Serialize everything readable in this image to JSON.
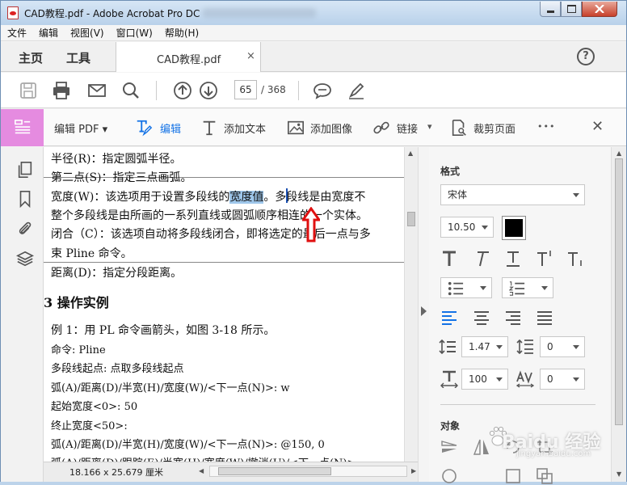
{
  "window": {
    "title": "CAD教程.pdf - Adobe Acrobat Pro DC"
  },
  "menu": [
    "文件",
    "编辑",
    "视图(V)",
    "窗口(W)",
    "帮助(H)"
  ],
  "tabs": {
    "home": "主页",
    "tools": "工具",
    "document": "CAD教程.pdf",
    "close": "×"
  },
  "toolbar": {
    "page_current": "65",
    "page_total": "/ 368"
  },
  "editbar": {
    "edit_pdf": "编辑 PDF ▾",
    "edit": "编辑",
    "add_text": "添加文本",
    "add_image": "添加图像",
    "link": "链接",
    "link_caret": "▾",
    "crop": "裁剪页面",
    "more": "•••",
    "close": "✕"
  },
  "document": {
    "lines": [
      "半径(R)：指定圆弧半径。",
      "第二点(S)：指定三点画弧。",
      "宽度(W)：该选项用于设置多段线的",
      "整个多段线是由所画的一系列直线或圆弧顺序相连的一个实体。",
      "闭合（C）：该选项自动将多段线闭合，即将选定的最后一点与多",
      "束 Pline 命令。",
      "距离(D)：指定分段距离。",
      "3 操作实例",
      "例 1：用 PL 命令画箭头，如图 3-18 所示。",
      "命令: Pline",
      "多段线起点: 点取多段线起点",
      "弧(A)/距离(D)/半宽(H)/宽度(W)/<下一点(N)>: w",
      "起始宽度<0>: 50",
      "终止宽度<50>:",
      "弧(A)/距离(D)/半宽(H)/宽度(W)/<下一点(N)>: @150, 0",
      "弧(A)/距离(D)/跟踪(E)/半宽(H)/宽度(W)/撤消(U)/<下一点(N)>:"
    ],
    "highlight": "宽度值",
    "line3_tail": "。多段线是由宽度不"
  },
  "status": {
    "page_size": "18.166 x 25.679 厘米"
  },
  "format_panel": {
    "title": "格式",
    "font": "宋体",
    "font_size": "10.50",
    "text_color": "#000000",
    "line_spacing": "1.47",
    "para_spacing": "0",
    "horiz_scale": "100",
    "char_spacing": "0"
  },
  "object_panel": {
    "title": "对象"
  },
  "watermark": {
    "main": "Baidu 经验",
    "sub": "jingyan.baidu.com"
  }
}
